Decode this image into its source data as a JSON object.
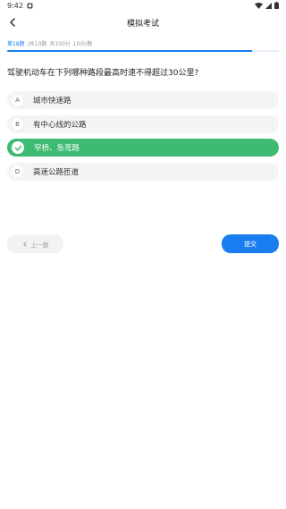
{
  "status": {
    "time": "9:42"
  },
  "header": {
    "title": "模拟考试"
  },
  "progress": {
    "current": "第18题",
    "total": "/共10题",
    "score": "共100分",
    "per": "10分/题",
    "fraction": 0.9
  },
  "question": {
    "text": "驾驶机动车在下列哪种路段最高时速不得超过30公里?"
  },
  "options": [
    {
      "letter": "A",
      "text": "城市快速路",
      "selected": false
    },
    {
      "letter": "B",
      "text": "有中心线的公路",
      "selected": false
    },
    {
      "letter": "C",
      "text": "窄桥、急弯路",
      "selected": true
    },
    {
      "letter": "D",
      "text": "高速公路匝道",
      "selected": false
    }
  ],
  "footer": {
    "prev_label": "上一题",
    "submit_label": "提交"
  },
  "colors": {
    "accent": "#1a7ef0",
    "selected": "#3dbb72"
  }
}
